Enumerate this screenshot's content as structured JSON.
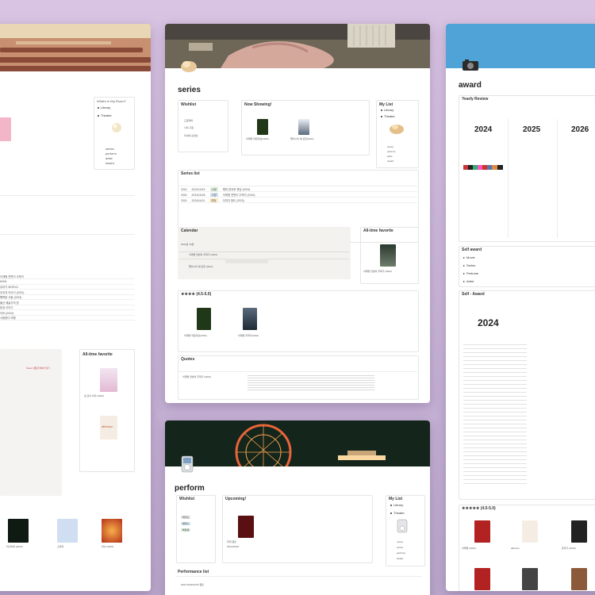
{
  "series_page": {
    "title": "series",
    "wishlist": {
      "title": "Wishlist",
      "items": [
        "드림캐처",
        "나의 구원",
        "미녀와 순정남"
      ]
    },
    "now_showing": {
      "title": "Now Showing!",
      "items": [
        "이재명 작은대선(2024)",
        "펠리시아 에 관한(2021)"
      ]
    },
    "my_list": {
      "title": "My List",
      "items": [
        "Library",
        "Theater"
      ],
      "links": [
        "series",
        "perform",
        "artist",
        "award"
      ]
    },
    "series_list": {
      "title": "Series list",
      "rows": [
        {
          "year": "2024",
          "date": "2024/10/19",
          "tag": "시청",
          "name": "해피 방과후 엔딩 (2024)"
        },
        {
          "year": "2024",
          "date": "2024/10/26",
          "tag": "시청",
          "name": "이재명 연변이 주택가 (2024)"
        },
        {
          "year": "2024",
          "date": "2024/11/01",
          "tag": "예정",
          "name": "이미지 정도 (2023)"
        }
      ]
    },
    "calendar": {
      "title": "Calendar",
      "month": "2024년 10월",
      "event1": "이재명 연변이 주택가 (2024)",
      "event2": "펠리시아 에 관한 (2021)"
    },
    "favorite": {
      "title": "All-time favorite",
      "caption": "이재명 연변이 주택가 (2024)"
    },
    "rating": {
      "title": "★★★★ (4.5-5.0)",
      "items": [
        "이재명 작은대선(2024)",
        "이재명 주택가(2024)"
      ]
    },
    "quotes": {
      "title": "Quotes",
      "source": "이재명 연변이 주택가 (2023)"
    }
  },
  "award_page": {
    "title": "award",
    "yearly": {
      "title": "Yearly Review",
      "years": [
        "2024",
        "2025",
        "2026"
      ]
    },
    "self_award": {
      "title": "Self award",
      "items": [
        "Movie",
        "Series",
        "Perfume",
        "Artist"
      ]
    },
    "self_award_year": {
      "title": "Self - Award",
      "year": "2024"
    },
    "rating": {
      "title": "★★★★★ (4.5-5.0)",
      "items": [
        "이재명 (2024)",
        "aftersun",
        "쥬라기 (2023)",
        "굴(2023)",
        "이기다 보면(2021)",
        "빈센조 (2021)"
      ]
    }
  },
  "perform_page": {
    "title": "perform",
    "wishlist": {
      "title": "Wishlist",
      "items": [
        "위키드",
        "멤피스",
        "베토벤"
      ]
    },
    "upcoming": {
      "title": "Upcoming!",
      "item": "무대 햄릿",
      "date": "2024/10/26"
    },
    "my_list": {
      "title": "My List",
      "items": [
        "Library",
        "Theater"
      ],
      "links": [
        "movie",
        "series",
        "perfume",
        "award"
      ]
    },
    "performance_list": {
      "title": "Performance list",
      "row": "2024  2024/10/26  햄릿"
    }
  },
  "left_page": {
    "my_room": "What's in My Room?",
    "links": [
      "Library",
      "Theater"
    ],
    "quick": [
      "series",
      "perform",
      "artist",
      "award"
    ],
    "favorite": "All-time favorite",
    "fav_items": [
      "살 곳이 바다 (2024)",
      "aftersun"
    ],
    "calendar_badge": "Notion 캘린더에서 열기",
    "list_rows": [
      "이재명 연변이 주택가",
      "NOW",
      "쥬라기 WORLD",
      "우리의 이야기 (2021)",
      "행복한 사람 (2023)",
      "울산 예술가의 밤",
      "한강 이야기",
      "이모 (2024)",
      "사랑한다 여행"
    ],
    "thumbs": [
      "미니어처 (2024)",
      "스위치",
      "하나 (2024)"
    ]
  },
  "colors": {
    "accent": "#e36b5b",
    "tag_green": "#dbeddb",
    "tag_blue": "#d3e5ef",
    "tag_yellow": "#fdecc8"
  }
}
